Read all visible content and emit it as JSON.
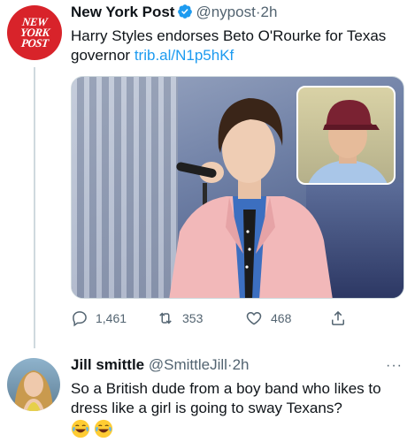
{
  "tweet": {
    "avatar_lines": [
      "NEW",
      "YORK",
      "POST"
    ],
    "author_name": "New York Post",
    "handle": "@nypost",
    "separator": "·",
    "time": "2h",
    "text": "Harry Styles endorses Beto O'Rourke for Texas governor ",
    "link": "trib.al/N1p5hKf",
    "stats": {
      "replies": "1,461",
      "retweets": "353",
      "likes": "468"
    }
  },
  "reply": {
    "author_name": "Jill smittle",
    "handle": "@SmittleJill",
    "separator": "·",
    "time": "2h",
    "more": "···",
    "text": "So a British dude from a boy band who likes to dress like a girl is going to sway Texans?"
  },
  "colors": {
    "accent": "#1d9bf0",
    "nyp_red": "#d8232a",
    "muted": "#536471"
  }
}
